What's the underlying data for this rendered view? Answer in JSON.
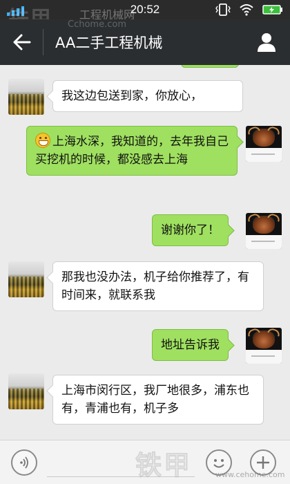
{
  "status_bar": {
    "time": "20:52",
    "watermark_logo": "铁甲",
    "watermark_site": "工程机械网",
    "watermark_url": "Cchome.com",
    "icons": [
      "signal-left-icon",
      "vibrate-icon",
      "wifi-icon",
      "battery-icon"
    ]
  },
  "header": {
    "title": "AA二手工程机械",
    "back_icon": "arrow-left-icon",
    "profile_icon": "person-icon"
  },
  "messages": [
    {
      "side": "left",
      "avatar": "crowd",
      "text": "我这边包送到家，你放心，"
    },
    {
      "side": "right",
      "avatar": "bull",
      "emoji": "grin-emoji",
      "text": "上海水深，我知道的，去年我自己买挖机的时候，都没感去上海"
    },
    {
      "side": "right",
      "avatar": "bull",
      "text": "谢谢你了！"
    },
    {
      "side": "left",
      "avatar": "crowd",
      "text": "那我也没办法，机子给你推荐了，有时间来，就联系我"
    },
    {
      "side": "right",
      "avatar": "bull",
      "text": "地址告诉我"
    },
    {
      "side": "left",
      "avatar": "crowd",
      "text": "上海市闵行区，我厂地很多，浦东也有，青浦也有，机子多"
    }
  ],
  "bottom_bar": {
    "voice_icon": "voice-icon",
    "emoji_icon": "smiley-icon",
    "add_icon": "plus-icon",
    "watermark_logo": "铁甲",
    "watermark_url": "www.cehome.com"
  },
  "colors": {
    "header_bg": "#2b2e31",
    "chat_bg": "#ebebeb",
    "bubble_right": "#9fe060",
    "bubble_left": "#ffffff"
  }
}
